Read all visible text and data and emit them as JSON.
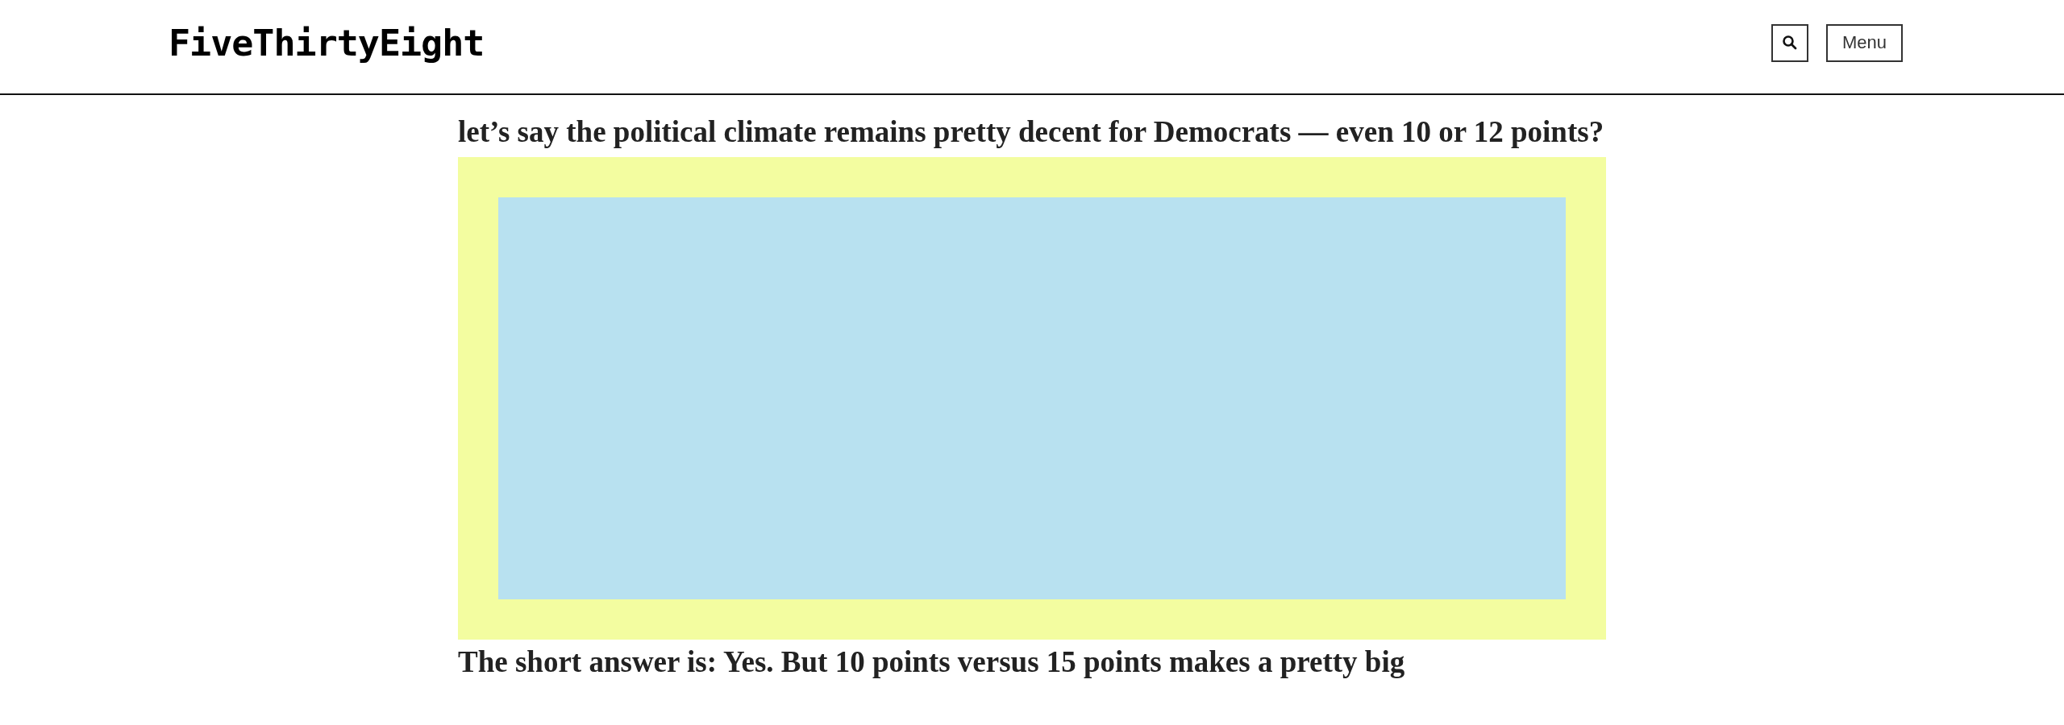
{
  "header": {
    "logo": "FiveThirtyEight",
    "menu_button": "Menu"
  },
  "article": {
    "paragraphs": [
      "let’s say the political climate remains pretty decent for Democrats — even 10 or 12 points?",
      "The short answer is: Yes. But 10 points versus 15 points makes a pretty big"
    ]
  }
}
